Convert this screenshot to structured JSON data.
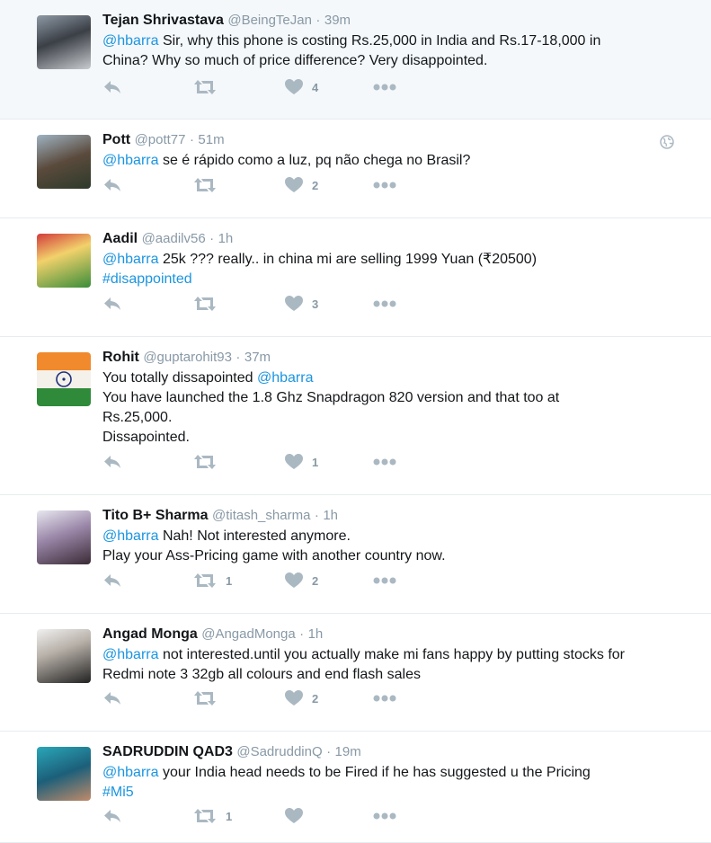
{
  "colors": {
    "link": "#1b95e0",
    "icon": "#aab8c2",
    "meta": "#8899a6",
    "highlight_bg": "#f5f8fa",
    "border": "#e6ecf0"
  },
  "icons": {
    "reply": "reply-icon",
    "retweet": "retweet-icon",
    "like": "heart-icon",
    "more": "more-icon",
    "globe": "globe-icon"
  },
  "tweets": [
    {
      "name": "Tejan Shrivastava",
      "handle": "@BeingTeJan",
      "sep": "·",
      "time": "39m",
      "lines": [
        [
          {
            "t": "@hbarra",
            "link": true
          },
          {
            "t": " Sir, why this phone is costing Rs.25,000 in India and Rs.17-18,000 in"
          }
        ],
        [
          {
            "t": "China? Why so much of price difference? Very disappointed."
          }
        ]
      ],
      "retweets": "",
      "likes": "4"
    },
    {
      "name": "Pott",
      "handle": "@pott77",
      "sep": "·",
      "time": "51m",
      "lines": [
        [
          {
            "t": "@hbarra",
            "link": true
          },
          {
            "t": " se é rápido como a luz, pq não chega no Brasil?"
          }
        ]
      ],
      "retweets": "",
      "likes": "2"
    },
    {
      "name": "Aadil",
      "handle": "@aadilv56",
      "sep": "·",
      "time": "1h",
      "lines": [
        [
          {
            "t": "@hbarra",
            "link": true
          },
          {
            "t": " 25k ??? really.. in china mi are selling 1999 Yuan (₹20500)"
          }
        ],
        [
          {
            "t": "#disappointed",
            "link": true
          }
        ]
      ],
      "retweets": "",
      "likes": "3"
    },
    {
      "name": "Rohit",
      "handle": "@guptarohit93",
      "sep": "·",
      "time": "37m",
      "lines": [
        [
          {
            "t": "You totally dissapointed "
          },
          {
            "t": "@hbarra",
            "link": true
          }
        ],
        [
          {
            "t": "You have launched the 1.8 Ghz Snapdragon 820 version and that too at"
          }
        ],
        [
          {
            "t": "Rs.25,000."
          }
        ],
        [
          {
            "t": "Dissapointed."
          }
        ]
      ],
      "retweets": "",
      "likes": "1"
    },
    {
      "name": "Tito B+ Sharma",
      "handle": "@titash_sharma",
      "sep": "·",
      "time": "1h",
      "lines": [
        [
          {
            "t": "@hbarra",
            "link": true
          },
          {
            "t": " Nah! Not interested anymore."
          }
        ],
        [
          {
            "t": "Play your Ass-Pricing game with another country now."
          }
        ]
      ],
      "retweets": "1",
      "likes": "2"
    },
    {
      "name": "Angad Monga",
      "handle": "@AngadMonga",
      "sep": "·",
      "time": "1h",
      "lines": [
        [
          {
            "t": "@hbarra",
            "link": true
          },
          {
            "t": " not interested.until you actually make mi fans happy by putting stocks for"
          }
        ],
        [
          {
            "t": "Redmi note 3 32gb all colours and end flash sales"
          }
        ]
      ],
      "retweets": "",
      "likes": "2"
    },
    {
      "name": "SADRUDDIN QAD3",
      "handle": "@SadruddinQ",
      "sep": "·",
      "time": "19m",
      "lines": [
        [
          {
            "t": "@hbarra",
            "link": true
          },
          {
            "t": " your India head needs to be Fired if he has suggested u the Pricing"
          }
        ],
        [
          {
            "t": "#Mi5",
            "link": true
          }
        ]
      ],
      "retweets": "1",
      "likes": ""
    }
  ]
}
